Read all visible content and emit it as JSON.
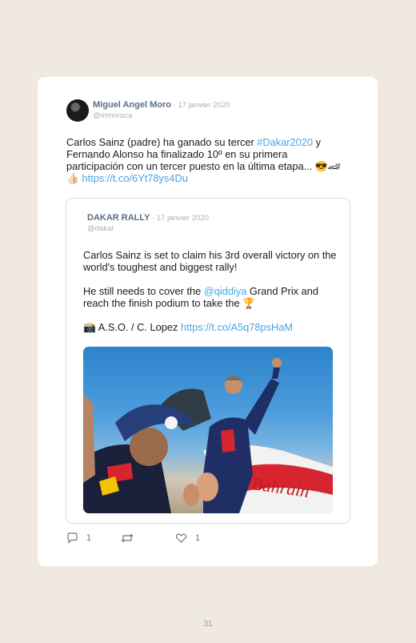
{
  "tweet": {
    "author_name": "Miguel Angel Moro",
    "separator": " · ",
    "date": "17 janvier 2020",
    "handle": "@mmoroca",
    "text_1": "Carlos Sainz (padre) ha ganado su tercer ",
    "hashtag": "#Dakar2020",
    "text_2": " y Fernando Alonso ha finalizado 10º en su primera participación con un tercer puesto en la última etapa... 😎🏎",
    "text_3": "👍🏻 ",
    "link": "https://t.co/6Yt78ys4Du"
  },
  "quote": {
    "author_name": "DAKAR RALLY",
    "separator": " · ",
    "date": "17 janvier 2020",
    "handle": "@dakar",
    "p1": "Carlos Sainz is set to claim his 3rd overall victory on the world's toughest and biggest rally!",
    "p2_a": "He still needs to cover the ",
    "mention": "@qiddiya",
    "p2_b": " Grand Prix and reach the finish podium to take the 🏆",
    "p3_a": "📸 A.S.O. / C. Lopez ",
    "p3_link": "https://t.co/A5q78psHaM",
    "photo_caption": "Bahrain"
  },
  "actions": {
    "reply_count": "1",
    "like_count": "1"
  },
  "page_number": "31"
}
